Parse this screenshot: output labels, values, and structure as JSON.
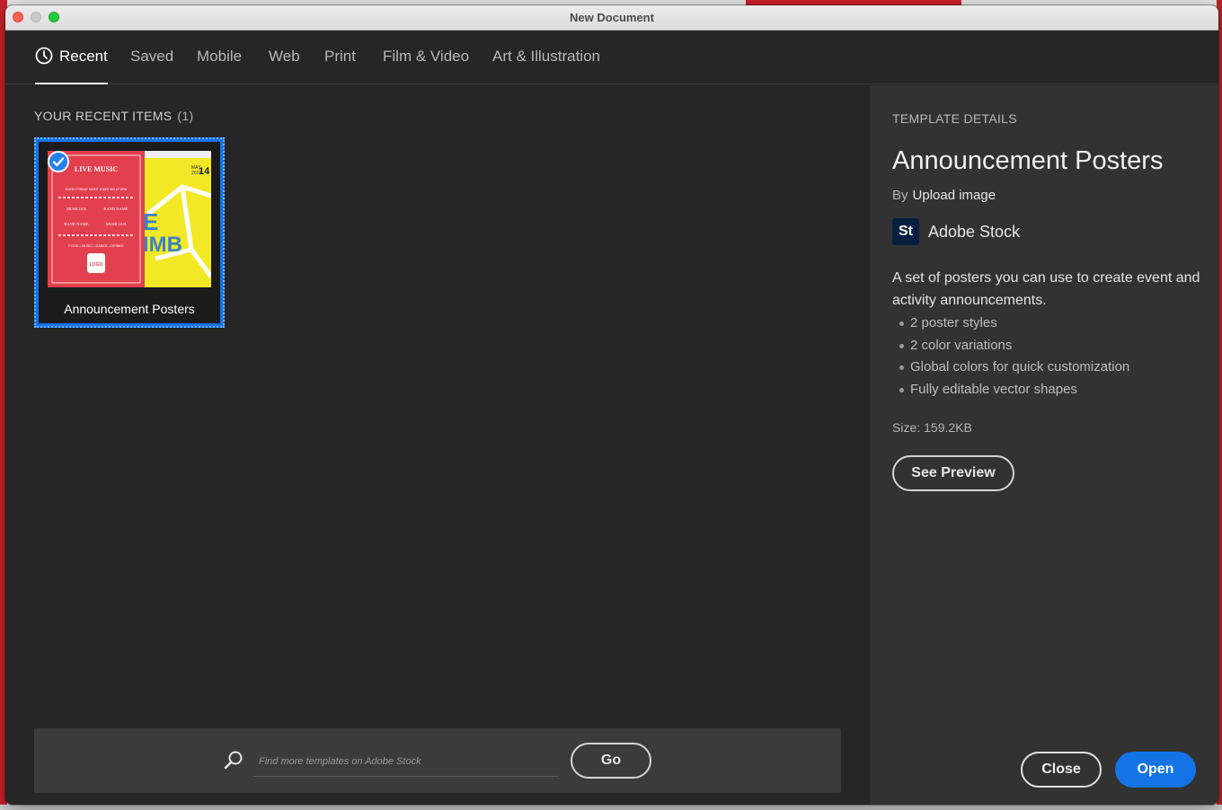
{
  "window": {
    "title": "New Document"
  },
  "tabs": [
    {
      "label": "Recent",
      "active": true,
      "icon": "clock-icon"
    },
    {
      "label": "Saved"
    },
    {
      "label": "Mobile"
    },
    {
      "label": "Web"
    },
    {
      "label": "Print"
    },
    {
      "label": "Film & Video"
    },
    {
      "label": "Art & Illustration"
    }
  ],
  "recent": {
    "heading": "YOUR RECENT ITEMS",
    "count": "(1)",
    "items": [
      {
        "label": "Announcement Posters",
        "selected": true,
        "thumb_text": {
          "header": "LIVE MUSIC",
          "subtitle": "EVERY FRIDAY NIGHT STARTING AT 8PM",
          "musician": "MUSICIAN",
          "band": "BAND NAME",
          "footer": "FOOD • MUSIC • DANCE • DRINKS",
          "logo": "LOGO",
          "yellow_date_top": "MAY",
          "yellow_date_year": "2019",
          "yellow_day": "14",
          "yellow_big_1": "E",
          "yellow_big_2": "IMB"
        }
      }
    ]
  },
  "search": {
    "placeholder": "Find more templates on Adobe Stock",
    "go_label": "Go"
  },
  "details": {
    "section_title": "TEMPLATE DETAILS",
    "name": "Announcement Posters",
    "by_label": "By",
    "author": "Upload image",
    "source_logo": "St",
    "source_name": "Adobe Stock",
    "description": "A set of posters you can use to create event and activity announcements.",
    "features": [
      "2 poster styles",
      "2 color variations",
      "Global colors for quick customization",
      "Fully editable vector shapes"
    ],
    "size_label": "Size:",
    "size_value": "159.2KB",
    "preview_label": "See Preview"
  },
  "footer": {
    "close_label": "Close",
    "open_label": "Open"
  },
  "colors": {
    "accent": "#1473e6",
    "background": "#262626",
    "panel": "#323232",
    "poster_red": "#e2404e",
    "poster_yellow": "#f3e826"
  }
}
